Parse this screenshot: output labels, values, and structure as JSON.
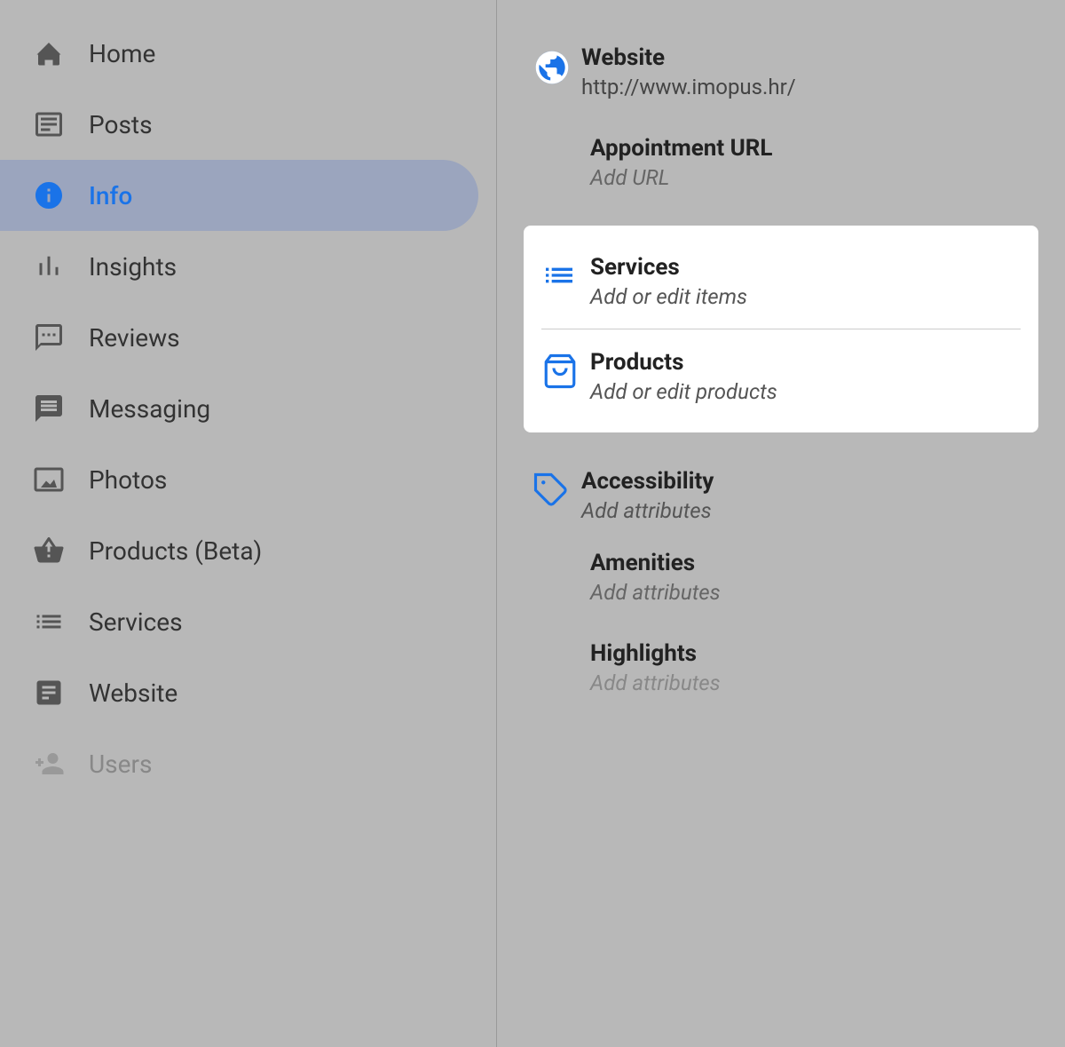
{
  "nav": {
    "items": [
      {
        "id": "home",
        "label": "Home",
        "icon": "home-icon",
        "active": false,
        "disabled": false
      },
      {
        "id": "posts",
        "label": "Posts",
        "icon": "posts-icon",
        "active": false,
        "disabled": false
      },
      {
        "id": "info",
        "label": "Info",
        "icon": "info-icon",
        "active": true,
        "disabled": false
      },
      {
        "id": "insights",
        "label": "Insights",
        "icon": "insights-icon",
        "active": false,
        "disabled": false
      },
      {
        "id": "reviews",
        "label": "Reviews",
        "icon": "reviews-icon",
        "active": false,
        "disabled": false
      },
      {
        "id": "messaging",
        "label": "Messaging",
        "icon": "messaging-icon",
        "active": false,
        "disabled": false
      },
      {
        "id": "photos",
        "label": "Photos",
        "icon": "photos-icon",
        "active": false,
        "disabled": false
      },
      {
        "id": "products-beta",
        "label": "Products (Beta)",
        "icon": "products-beta-icon",
        "active": false,
        "disabled": false
      },
      {
        "id": "services",
        "label": "Services",
        "icon": "services-icon",
        "active": false,
        "disabled": false
      },
      {
        "id": "website",
        "label": "Website",
        "icon": "website-icon",
        "active": false,
        "disabled": false
      },
      {
        "id": "users",
        "label": "Users",
        "icon": "users-icon",
        "active": false,
        "disabled": true
      }
    ]
  },
  "right": {
    "website": {
      "title": "Website",
      "value": "http://www.imopus.hr/"
    },
    "appointment_url": {
      "title": "Appointment URL",
      "subtitle": "Add URL"
    },
    "services": {
      "title": "Services",
      "subtitle": "Add or edit items"
    },
    "products": {
      "title": "Products",
      "subtitle": "Add or edit products"
    },
    "accessibility": {
      "title": "Accessibility",
      "subtitle": "Add attributes"
    },
    "amenities": {
      "title": "Amenities",
      "subtitle": "Add attributes"
    },
    "highlights": {
      "title": "Highlights",
      "subtitle": "Add attributes"
    }
  }
}
